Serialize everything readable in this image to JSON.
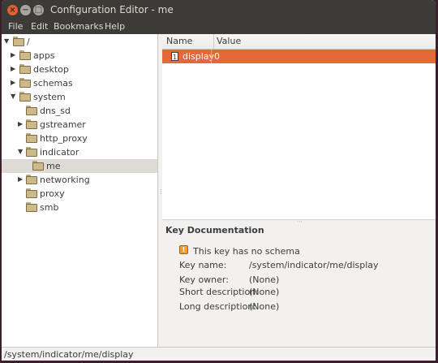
{
  "window": {
    "title": "Configuration Editor - me",
    "close_glyph": "×",
    "minimize_glyph": "−",
    "maximize_glyph": "□"
  },
  "menubar": {
    "items": [
      "File",
      "Edit",
      "Bookmarks",
      "Help"
    ]
  },
  "tree": {
    "root": "/",
    "items": [
      {
        "label": "apps",
        "expander": "▶",
        "expanded": false
      },
      {
        "label": "desktop",
        "expander": "▶",
        "expanded": false
      },
      {
        "label": "schemas",
        "expander": "▶",
        "expanded": false
      },
      {
        "label": "system",
        "expander": "▼",
        "expanded": true
      },
      {
        "label": "dns_sd",
        "expander": "",
        "expanded": false
      },
      {
        "label": "gstreamer",
        "expander": "▶",
        "expanded": false
      },
      {
        "label": "http_proxy",
        "expander": "",
        "expanded": false
      },
      {
        "label": "indicator",
        "expander": "▼",
        "expanded": true
      },
      {
        "label": "me",
        "expander": "",
        "expanded": false,
        "selected": true
      },
      {
        "label": "networking",
        "expander": "▶",
        "expanded": false
      },
      {
        "label": "proxy",
        "expander": "",
        "expanded": false
      },
      {
        "label": "smb",
        "expander": "",
        "expanded": false
      }
    ]
  },
  "keys_table": {
    "headers": {
      "name": "Name",
      "value": "Value"
    },
    "rows": [
      {
        "name": "display",
        "value": "0",
        "selected": true
      }
    ]
  },
  "key_documentation": {
    "title": "Key Documentation",
    "notice": "This key has no schema",
    "fields": [
      {
        "label": "Key name:",
        "value": "/system/indicator/me/display"
      },
      {
        "label": "Key owner:",
        "value": "(None)"
      },
      {
        "label": "Short description:",
        "value": "(None)"
      },
      {
        "label": "Long description:",
        "value": "(None)"
      }
    ]
  },
  "statusbar": {
    "path": "/system/indicator/me/display"
  },
  "colors": {
    "selection": "#e46838",
    "titlebar": "#3c3b37",
    "close_button": "#e35f30"
  }
}
